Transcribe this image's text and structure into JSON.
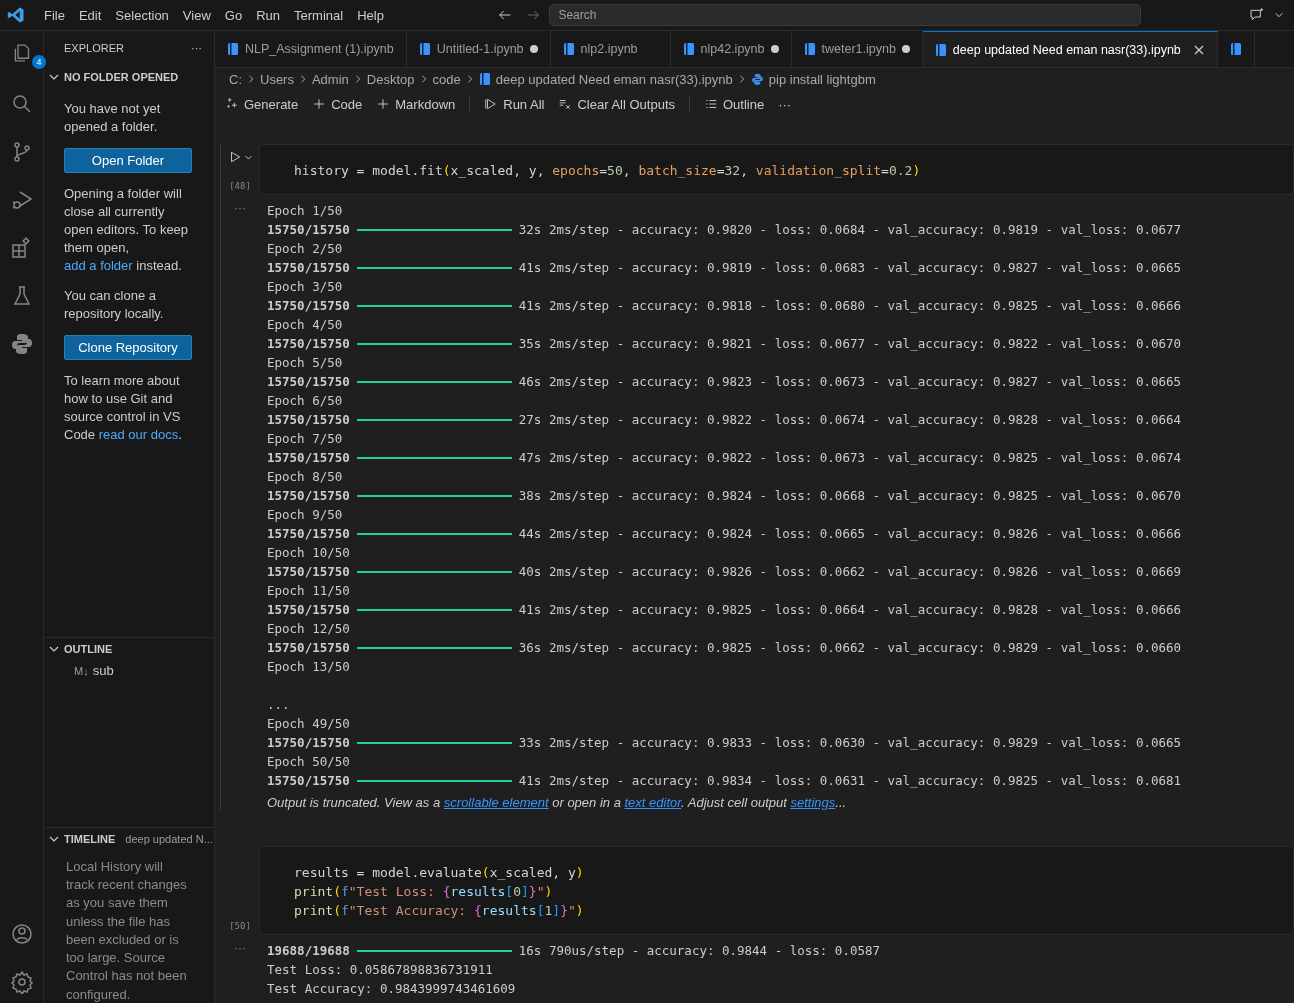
{
  "menu": [
    "File",
    "Edit",
    "Selection",
    "View",
    "Go",
    "Run",
    "Terminal",
    "Help"
  ],
  "search": {
    "placeholder": "Search"
  },
  "activity": {
    "badge": "4"
  },
  "sidebar": {
    "title": "EXPLORER",
    "more": "···",
    "explorer": {
      "heading": "NO FOLDER OPENED",
      "expanded": true,
      "paragraphs_1": [
        [
          {
            "text": "You have not yet opened a folder."
          }
        ]
      ],
      "open_button": "Open Folder",
      "paragraphs_2": [
        [
          {
            "text": "Opening a folder will close all currently open editors. To keep them open, "
          },
          {
            "text": "add a folder",
            "link": true
          },
          {
            "text": " instead."
          }
        ],
        [
          {
            "text": "You can clone a repository locally."
          }
        ]
      ],
      "clone_button": "Clone Repository",
      "paragraphs_3": [
        [
          {
            "text": "To learn more about how to use Git and source control in VS Code "
          },
          {
            "text": "read our docs",
            "link": true
          },
          {
            "text": "."
          }
        ]
      ]
    },
    "outline": {
      "heading": "OUTLINE",
      "expanded": true,
      "items": [
        {
          "icon": "M↓",
          "label": "sub"
        }
      ]
    },
    "timeline": {
      "heading": "TIMELINE",
      "subtitle": "deep updated N...",
      "expanded": true,
      "message": "Local History will track recent changes as you save them unless the file has been excluded or is too large. Source Control has not been configured."
    }
  },
  "tabs": [
    {
      "label": "NLP_Assignment (1).ipynb",
      "dirty": false,
      "selected": false
    },
    {
      "label": "Untitled-1.ipynb",
      "dirty": true,
      "selected": false
    },
    {
      "label": "nlp2.ipynb",
      "dirty": false,
      "selected": false
    },
    {
      "label": "nlp42.ipynb",
      "dirty": true,
      "selected": false
    },
    {
      "label": "tweter1.ipynb",
      "dirty": true,
      "selected": false
    },
    {
      "label": "deep updated Need eman nasr(33).ipynb",
      "dirty": false,
      "selected": true
    }
  ],
  "breadcrumb": [
    {
      "label": "C:",
      "kind": "folder"
    },
    {
      "label": "Users",
      "kind": "folder"
    },
    {
      "label": "Admin",
      "kind": "folder"
    },
    {
      "label": "Desktop",
      "kind": "folder"
    },
    {
      "label": "code",
      "kind": "folder"
    },
    {
      "label": "deep updated  Need  eman nasr(33).ipynb",
      "kind": "notebook"
    },
    {
      "label": "pip install lightgbm",
      "kind": "python"
    }
  ],
  "toolbar": [
    {
      "label": "Generate",
      "kind": "sparkle"
    },
    {
      "label": "Code",
      "kind": "plus"
    },
    {
      "label": "Markdown",
      "kind": "plus"
    },
    {
      "label": "Run All",
      "kind": "run",
      "separator_before": true
    },
    {
      "label": "Clear All Outputs",
      "kind": "clear"
    },
    {
      "label": "Outline",
      "kind": "list",
      "separator_before": true
    },
    {
      "label": "···",
      "kind": "more"
    }
  ],
  "cells": [
    {
      "execution_count": "[48]",
      "focused": true,
      "output_marker": "···",
      "code": [
        [
          {
            "t": "history = model.fit",
            "kind": "text"
          },
          {
            "t": "(",
            "kind": "bracket"
          },
          {
            "t": "x_scaled, y, ",
            "kind": "text"
          },
          {
            "t": "epochs",
            "kind": "param"
          },
          {
            "t": "=",
            "kind": "text"
          },
          {
            "t": "50",
            "kind": "number"
          },
          {
            "t": ", ",
            "kind": "text"
          },
          {
            "t": "batch_size",
            "kind": "param"
          },
          {
            "t": "=",
            "kind": "text"
          },
          {
            "t": "32",
            "kind": "number"
          },
          {
            "t": ", ",
            "kind": "text"
          },
          {
            "t": "validation_split",
            "kind": "param"
          },
          {
            "t": "=",
            "kind": "text"
          },
          {
            "t": "0.2",
            "kind": "number"
          },
          {
            "t": ")",
            "kind": "bracket"
          }
        ]
      ],
      "output": [
        {
          "kind": "text",
          "text": "Epoch 1/50"
        },
        {
          "kind": "progress",
          "count": "15750/15750",
          "text": "32s 2ms/step - accuracy: 0.9820 - loss: 0.0684 - val_accuracy: 0.9819 - val_loss: 0.0677"
        },
        {
          "kind": "text",
          "text": "Epoch 2/50"
        },
        {
          "kind": "progress",
          "count": "15750/15750",
          "text": "41s 2ms/step - accuracy: 0.9819 - loss: 0.0683 - val_accuracy: 0.9827 - val_loss: 0.0665"
        },
        {
          "kind": "text",
          "text": "Epoch 3/50"
        },
        {
          "kind": "progress",
          "count": "15750/15750",
          "text": "41s 2ms/step - accuracy: 0.9818 - loss: 0.0680 - val_accuracy: 0.9825 - val_loss: 0.0666"
        },
        {
          "kind": "text",
          "text": "Epoch 4/50"
        },
        {
          "kind": "progress",
          "count": "15750/15750",
          "text": "35s 2ms/step - accuracy: 0.9821 - loss: 0.0677 - val_accuracy: 0.9822 - val_loss: 0.0670"
        },
        {
          "kind": "text",
          "text": "Epoch 5/50"
        },
        {
          "kind": "progress",
          "count": "15750/15750",
          "text": "46s 2ms/step - accuracy: 0.9823 - loss: 0.0673 - val_accuracy: 0.9827 - val_loss: 0.0665"
        },
        {
          "kind": "text",
          "text": "Epoch 6/50"
        },
        {
          "kind": "progress",
          "count": "15750/15750",
          "text": "27s 2ms/step - accuracy: 0.9822 - loss: 0.0674 - val_accuracy: 0.9828 - val_loss: 0.0664"
        },
        {
          "kind": "text",
          "text": "Epoch 7/50"
        },
        {
          "kind": "progress",
          "count": "15750/15750",
          "text": "47s 2ms/step - accuracy: 0.9822 - loss: 0.0673 - val_accuracy: 0.9825 - val_loss: 0.0674"
        },
        {
          "kind": "text",
          "text": "Epoch 8/50"
        },
        {
          "kind": "progress",
          "count": "15750/15750",
          "text": "38s 2ms/step - accuracy: 0.9824 - loss: 0.0668 - val_accuracy: 0.9825 - val_loss: 0.0670"
        },
        {
          "kind": "text",
          "text": "Epoch 9/50"
        },
        {
          "kind": "progress",
          "count": "15750/15750",
          "text": "44s 2ms/step - accuracy: 0.9824 - loss: 0.0665 - val_accuracy: 0.9826 - val_loss: 0.0666"
        },
        {
          "kind": "text",
          "text": "Epoch 10/50"
        },
        {
          "kind": "progress",
          "count": "15750/15750",
          "text": "40s 2ms/step - accuracy: 0.9826 - loss: 0.0662 - val_accuracy: 0.9826 - val_loss: 0.0669"
        },
        {
          "kind": "text",
          "text": "Epoch 11/50"
        },
        {
          "kind": "progress",
          "count": "15750/15750",
          "text": "41s 2ms/step - accuracy: 0.9825 - loss: 0.0664 - val_accuracy: 0.9828 - val_loss: 0.0666"
        },
        {
          "kind": "text",
          "text": "Epoch 12/50"
        },
        {
          "kind": "progress",
          "count": "15750/15750",
          "text": "36s 2ms/step - accuracy: 0.9825 - loss: 0.0662 - val_accuracy: 0.9829 - val_loss: 0.0660"
        },
        {
          "kind": "text",
          "text": "Epoch 13/50"
        },
        {
          "kind": "blank"
        },
        {
          "kind": "text",
          "text": "..."
        },
        {
          "kind": "text",
          "text": "Epoch 49/50"
        },
        {
          "kind": "progress",
          "count": "15750/15750",
          "text": "33s 2ms/step - accuracy: 0.9833 - loss: 0.0630 - val_accuracy: 0.9829 - val_loss: 0.0665"
        },
        {
          "kind": "text",
          "text": "Epoch 50/50"
        },
        {
          "kind": "progress",
          "count": "15750/15750",
          "text": "41s 2ms/step - accuracy: 0.9834 - loss: 0.0631 - val_accuracy: 0.9825 - val_loss: 0.0681"
        }
      ],
      "truncated_notice": [
        {
          "text": "Output is truncated. View as a "
        },
        {
          "text": "scrollable element",
          "link": true
        },
        {
          "text": " or open in a "
        },
        {
          "text": "text editor",
          "link": true
        },
        {
          "text": ". Adjust cell output "
        },
        {
          "text": "settings",
          "link": true
        },
        {
          "text": "..."
        }
      ]
    },
    {
      "execution_count": "[50]",
      "focused": false,
      "output_marker": "···",
      "code": [
        [
          {
            "t": "results = model.evaluate",
            "kind": "text"
          },
          {
            "t": "(",
            "kind": "bracket"
          },
          {
            "t": "x_scaled, y",
            "kind": "text"
          },
          {
            "t": ")",
            "kind": "bracket"
          }
        ],
        [
          {
            "t": "print",
            "kind": "func"
          },
          {
            "t": "(",
            "kind": "bracket"
          },
          {
            "t": "f",
            "kind": "keyword"
          },
          {
            "t": "\"Test Loss: ",
            "kind": "string"
          },
          {
            "t": "{",
            "kind": "bracket2"
          },
          {
            "t": "results",
            "kind": "variable"
          },
          {
            "t": "[",
            "kind": "bracket3"
          },
          {
            "t": "0",
            "kind": "number"
          },
          {
            "t": "]",
            "kind": "bracket3"
          },
          {
            "t": "}",
            "kind": "bracket2"
          },
          {
            "t": "\"",
            "kind": "string"
          },
          {
            "t": ")",
            "kind": "bracket"
          }
        ],
        [
          {
            "t": "print",
            "kind": "func"
          },
          {
            "t": "(",
            "kind": "bracket"
          },
          {
            "t": "f",
            "kind": "keyword"
          },
          {
            "t": "\"Test Accuracy: ",
            "kind": "string"
          },
          {
            "t": "{",
            "kind": "bracket2"
          },
          {
            "t": "results",
            "kind": "variable"
          },
          {
            "t": "[",
            "kind": "bracket3"
          },
          {
            "t": "1",
            "kind": "number"
          },
          {
            "t": "]",
            "kind": "bracket3"
          },
          {
            "t": "}",
            "kind": "bracket2"
          },
          {
            "t": "\"",
            "kind": "string"
          },
          {
            "t": ")",
            "kind": "bracket"
          }
        ]
      ],
      "output": [
        {
          "kind": "progress",
          "count": "19688/19688",
          "text": "16s 790us/step - accuracy: 0.9844 - loss: 0.0587"
        },
        {
          "kind": "text",
          "text": "Test Loss: 0.05867898836731911"
        },
        {
          "kind": "text",
          "text": "Test Accuracy: 0.9843999743461609"
        }
      ]
    }
  ]
}
